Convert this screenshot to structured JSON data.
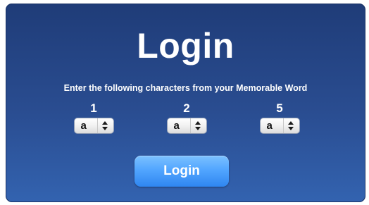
{
  "login": {
    "title": "Login",
    "instructions": "Enter the following characters from your Memorable Word",
    "positions": [
      {
        "number": "1",
        "selected_value": "a"
      },
      {
        "number": "2",
        "selected_value": "a"
      },
      {
        "number": "5",
        "selected_value": "a"
      }
    ],
    "button_label": "Login"
  },
  "colors": {
    "panel_top": "#1f3c78",
    "panel_bottom": "#3363b0",
    "button": "#52a6ff",
    "text": "#ffffff"
  },
  "icons": {
    "select_arrows": "up-down-chevrons-icon"
  }
}
